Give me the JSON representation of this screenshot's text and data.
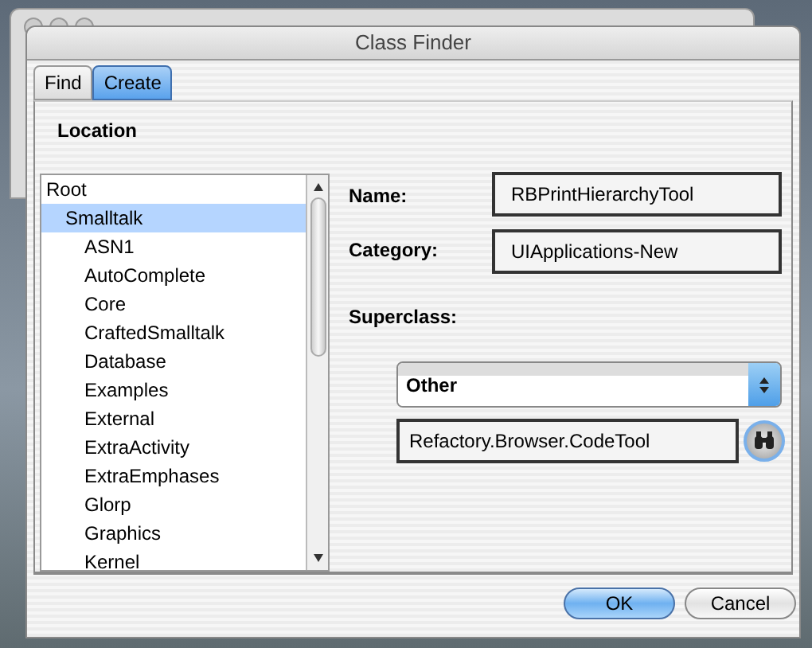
{
  "window": {
    "title": "Class Finder"
  },
  "tabs": [
    {
      "label": "Find",
      "selected": false
    },
    {
      "label": "Create",
      "selected": true
    }
  ],
  "location": {
    "label": "Location",
    "tree": [
      {
        "label": "Root",
        "selected": false,
        "children": [
          {
            "label": "Smalltalk",
            "selected": true,
            "children": [
              {
                "label": "ASN1",
                "selected": false
              },
              {
                "label": "AutoComplete",
                "selected": false
              },
              {
                "label": "Core",
                "selected": false
              },
              {
                "label": "CraftedSmalltalk",
                "selected": false
              },
              {
                "label": "Database",
                "selected": false
              },
              {
                "label": "Examples",
                "selected": false
              },
              {
                "label": "External",
                "selected": false
              },
              {
                "label": "ExtraActivity",
                "selected": false
              },
              {
                "label": "ExtraEmphases",
                "selected": false
              },
              {
                "label": "Glorp",
                "selected": false
              },
              {
                "label": "Graphics",
                "selected": false
              },
              {
                "label": "Kernel",
                "selected": false
              }
            ]
          }
        ]
      }
    ]
  },
  "form": {
    "name_label": "Name:",
    "name_value": "RBPrintHierarchyTool",
    "category_label": "Category:",
    "category_value": "UIApplications-New",
    "superclass_label": "Superclass:",
    "superclass_choice": "Other",
    "superclass_value": "Refactory.Browser.CodeTool"
  },
  "buttons": [
    {
      "label": "OK",
      "kind": "default"
    },
    {
      "label": "Cancel",
      "kind": "normal"
    }
  ]
}
